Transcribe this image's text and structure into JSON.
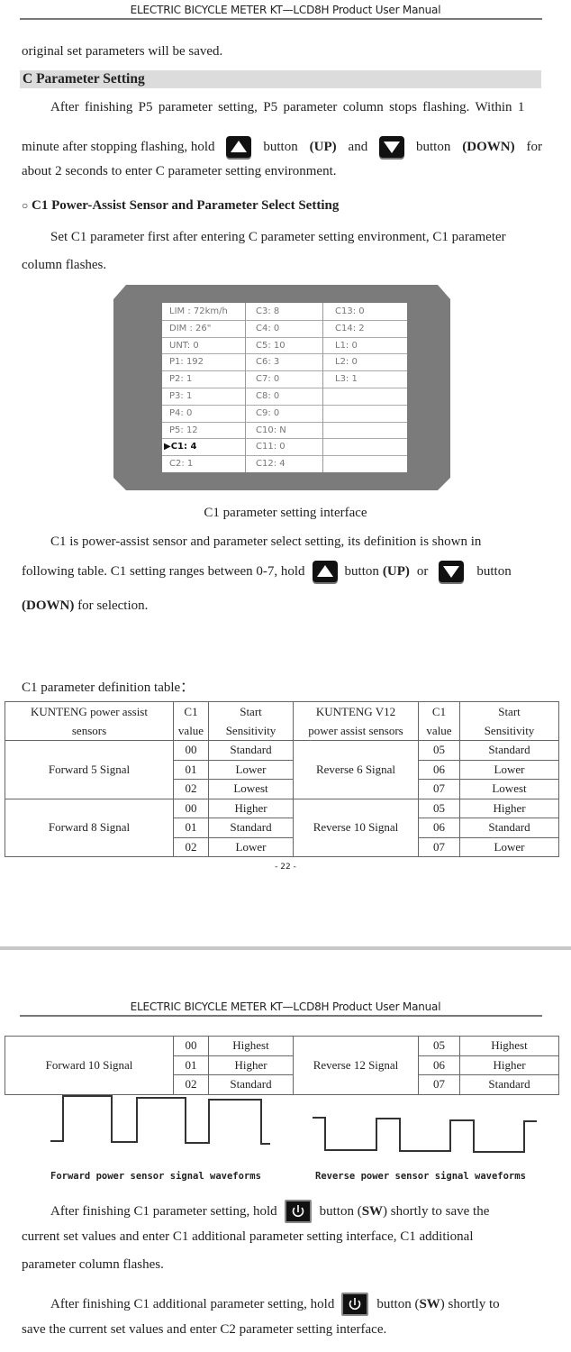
{
  "page1": {
    "header": "ELECTRIC BICYCLE METER KT—LCD8H Product User Manual",
    "line_saved": "original set parameters will be saved.",
    "section_title": "C Parameter Setting",
    "para1": {
      "l1": "After finishing P5 parameter setting, P5 parameter column stops flashing. Within 1",
      "l2a": "minute after stopping flashing, hold",
      "l2b": "button",
      "l2c": "(UP)",
      "l2d": "and",
      "l2e": "button",
      "l2f": "(DOWN)",
      "l2g": "for",
      "l3": "about 2 seconds to enter C parameter setting environment."
    },
    "subsection": {
      "bullet": "○",
      "title": "C1 Power-Assist Sensor and Parameter Select Setting"
    },
    "para2": {
      "l1": "Set C1 parameter first after entering C parameter setting environment, C1 parameter",
      "l2": "column flashes."
    },
    "lcd": {
      "columns": [
        [
          "LIM : 72km/h",
          "DIM : 26\"",
          "UNT:  0",
          "P1:  192",
          "P2:  1",
          "P3:  1",
          "P4:  0",
          "P5:  12",
          "C1:  4",
          "C2:  1"
        ],
        [
          "C3:  8",
          "C4:  0",
          "C5:  10",
          "C6:  3",
          "C7:  0",
          "C8:  0",
          "C9:  0",
          "C10:  N",
          "C11:  0",
          "C12:  4"
        ],
        [
          "C13:  0",
          "C14:  2",
          "L1:  0",
          "L2:  0",
          "L3:  1",
          "",
          "",
          "",
          "",
          ""
        ]
      ],
      "selected_marker": "▶",
      "selected": "C1"
    },
    "figure_caption": "C1 parameter setting interface",
    "para3": {
      "l1": "C1 is power-assist sensor and parameter select setting, its definition is shown in",
      "l2a": "following table. C1 setting ranges between 0-7, hold",
      "l2b": "button",
      "l2c": "(UP)",
      "l2d": "or",
      "l2e": "button",
      "l3a": "(DOWN)",
      "l3b": "for selection."
    },
    "table_title": "C1 parameter definition table：",
    "table": {
      "headers": [
        "KUNTENG power assist sensors",
        "C1 value",
        "Start Sensitivity",
        "KUNTENG V12 power assist sensors",
        "C1 value",
        "Start Sensitivity"
      ],
      "header_lines": [
        [
          "KUNTENG power assist",
          "sensors"
        ],
        [
          "C1",
          "value"
        ],
        [
          "Start",
          "Sensitivity"
        ],
        [
          "KUNTENG V12",
          "power assist sensors"
        ],
        [
          "C1",
          "value"
        ],
        [
          "Start",
          "Sensitivity"
        ]
      ],
      "groups": [
        {
          "left": "Forward 5 Signal",
          "lrows": [
            [
              "00",
              "Standard"
            ],
            [
              "01",
              "Lower"
            ],
            [
              "02",
              "Lowest"
            ]
          ],
          "right": "Reverse 6 Signal",
          "rrows": [
            [
              "05",
              "Standard"
            ],
            [
              "06",
              "Lower"
            ],
            [
              "07",
              "Lowest"
            ]
          ]
        },
        {
          "left": "Forward 8 Signal",
          "lrows": [
            [
              "00",
              "Higher"
            ],
            [
              "01",
              "Standard"
            ],
            [
              "02",
              "Lower"
            ]
          ],
          "right": "Reverse 10 Signal",
          "rrows": [
            [
              "05",
              "Higher"
            ],
            [
              "06",
              "Standard"
            ],
            [
              "07",
              "Lower"
            ]
          ]
        }
      ]
    },
    "page_number": "- 22 -"
  },
  "page2": {
    "header": "ELECTRIC BICYCLE METER KT—LCD8H Product User Manual",
    "table_cont": {
      "groups": [
        {
          "left": "Forward 10 Signal",
          "lrows": [
            [
              "00",
              "Highest"
            ],
            [
              "01",
              "Higher"
            ],
            [
              "02",
              "Standard"
            ]
          ],
          "right": "Reverse 12 Signal",
          "rrows": [
            [
              "05",
              "Highest"
            ],
            [
              "06",
              "Higher"
            ],
            [
              "07",
              "Standard"
            ]
          ]
        }
      ]
    },
    "waveforms": {
      "forward_caption": "Forward power sensor signal waveforms",
      "reverse_caption": "Reverse power sensor signal waveforms"
    },
    "para4": {
      "l1a": "After finishing C1 parameter setting, hold",
      "l1b": "button (",
      "l1c": "SW",
      "l1d": ") shortly to save the",
      "l2": "current set values and enter C1 additional parameter setting interface, C1 additional",
      "l3": "parameter column flashes."
    },
    "para5": {
      "l1a": "After finishing C1 additional parameter setting, hold",
      "l1b": "button (",
      "l1c": "SW",
      "l1d": ") shortly to",
      "l2": "save the current set values and enter C2 parameter setting interface."
    }
  }
}
